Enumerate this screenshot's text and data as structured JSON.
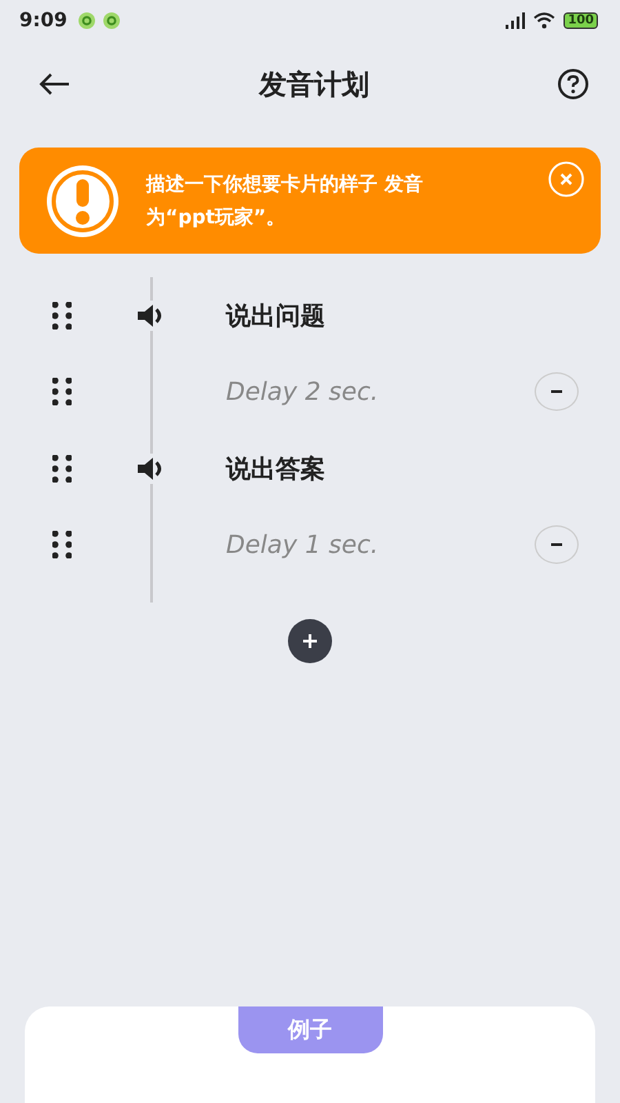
{
  "status_bar": {
    "time": "9:09",
    "battery": "100"
  },
  "header": {
    "title": "发音计划"
  },
  "banner": {
    "text": "描述一下你想要卡片的样子 发音为“ppt玩家”。"
  },
  "steps": [
    {
      "kind": "speak",
      "label": "说出问题"
    },
    {
      "kind": "delay",
      "label": "Delay 2 sec."
    },
    {
      "kind": "speak",
      "label": "说出答案"
    },
    {
      "kind": "delay",
      "label": "Delay 1 sec."
    }
  ],
  "example": {
    "tab": "例子"
  }
}
